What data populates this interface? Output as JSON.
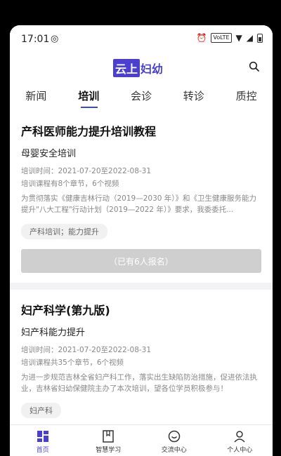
{
  "status": {
    "time": "17:01",
    "volte": "VoLTE"
  },
  "header": {
    "logo_box": "云上",
    "logo_rest": "妇幼"
  },
  "tabs": [
    "新闻",
    "培训",
    "会诊",
    "转诊",
    "质控"
  ],
  "cards": [
    {
      "title": "产科医师能力提升培训教程",
      "subtitle": "母婴安全培训",
      "time": "培训时间：2021-07-20至2022-08-31",
      "chapters": "培训课程有8个章节，6个视频",
      "desc": "为贯彻落实《健康吉林行动（2019—2030 年）》和《卫生健康服务能力提升\"八大工程\"行动计划（2019—2022 年）》要求，我委委托...",
      "tag": "产科培训；能力提升",
      "enroll": "（已有6人报名）"
    },
    {
      "title": "妇产科学(第九版)",
      "subtitle": "妇产科能力提升",
      "time": "培训时间：2021-07-20至2022-08-31",
      "chapters": "培训课程共35个章节，6个视频",
      "desc": "为进一步规范吉林全省妇产科工作，落实出生缺陷防治措施，促进依法执业，吉林省妇幼保健院主办了本次培训，望各位学员积极参与！",
      "tag": "妇产科",
      "enroll": ""
    }
  ],
  "bottom_nav": [
    "首页",
    "智慧学习",
    "交流中心",
    "个人中心"
  ],
  "colors": {
    "accent": "#4a3fd0"
  }
}
